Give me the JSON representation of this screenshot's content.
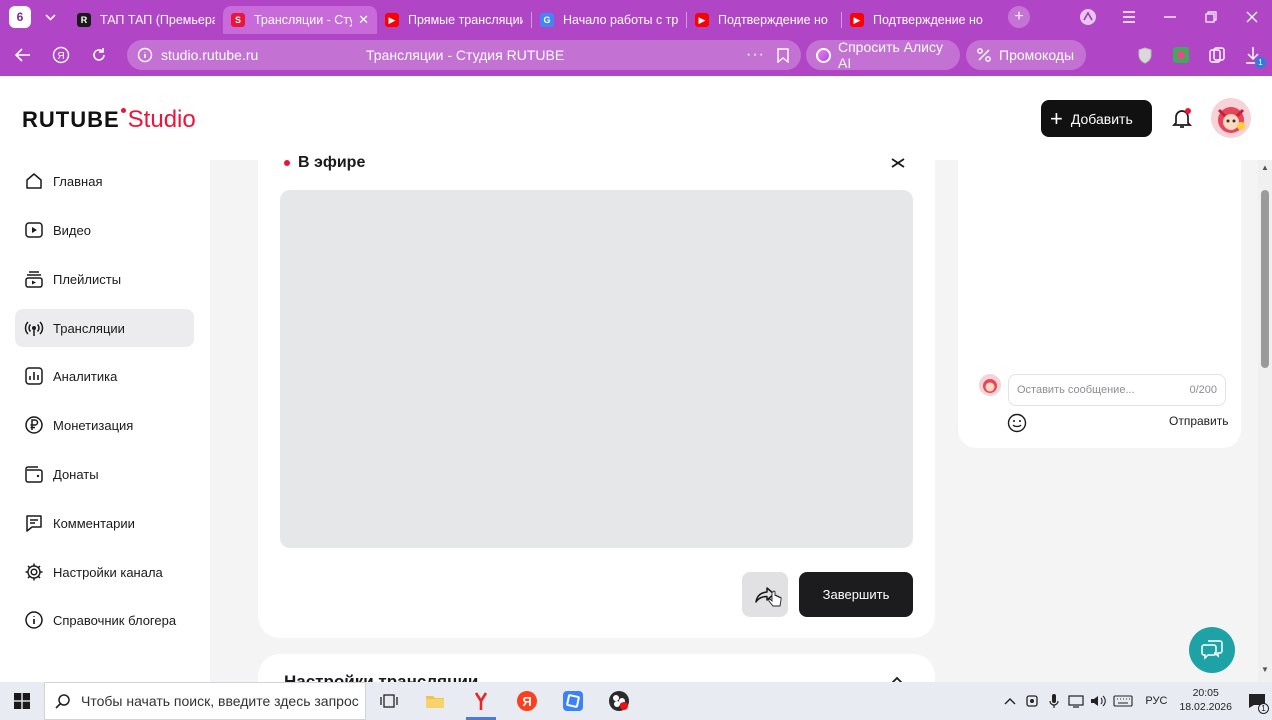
{
  "browser": {
    "tab_counter": "6",
    "tabs": [
      {
        "title": "ТАП ТАП (Премьера",
        "favicon": "rutube-favicon",
        "color": "#1a1a1a",
        "letter": "R"
      },
      {
        "title": "Трансляции - Сту",
        "favicon": "studio-favicon",
        "color": "#ed143b",
        "letter": "S",
        "active": true
      },
      {
        "title": "Прямые трансляции",
        "favicon": "youtube-favicon",
        "color": "#ff0000",
        "letter": "▶"
      },
      {
        "title": "Начало работы с тр",
        "favicon": "google-favicon",
        "color": "#4285f4",
        "letter": "G"
      },
      {
        "title": "Подтверждение но",
        "favicon": "youtube-favicon",
        "color": "#ff0000",
        "letter": "▶"
      },
      {
        "title": "Подтверждение но",
        "favicon": "youtube-favicon",
        "color": "#ff0000",
        "letter": "▶"
      }
    ],
    "url": "studio.rutube.ru",
    "page_title": "Трансляции - Студия RUTUBE",
    "alice_label": "Спросить Алису AI",
    "promo_label": "Промокоды",
    "ext_badge": "1"
  },
  "header": {
    "logo_main": "RUTUBE",
    "logo_studio": "Studio",
    "add_label": "Добавить"
  },
  "sidebar": {
    "items": [
      {
        "label": "Главная",
        "icon": "home-icon"
      },
      {
        "label": "Видео",
        "icon": "video-icon"
      },
      {
        "label": "Плейлисты",
        "icon": "playlist-icon"
      },
      {
        "label": "Трансляции",
        "icon": "broadcast-icon",
        "active": true
      },
      {
        "label": "Аналитика",
        "icon": "analytics-icon"
      },
      {
        "label": "Монетизация",
        "icon": "ruble-icon"
      },
      {
        "label": "Донаты",
        "icon": "wallet-icon"
      },
      {
        "label": "Комментарии",
        "icon": "comment-icon"
      },
      {
        "label": "Настройки канала",
        "icon": "gear-icon"
      },
      {
        "label": "Справочник блогера",
        "icon": "info-icon"
      }
    ]
  },
  "stream": {
    "status": "В эфире",
    "finish_label": "Завершить",
    "settings_title": "Настройки трансляции"
  },
  "chat": {
    "placeholder": "Оставить сообщение...",
    "counter": "0/200",
    "send_label": "Отправить"
  },
  "taskbar": {
    "search_placeholder": "Чтобы начать поиск, введите здесь запрос",
    "lang": "РУС",
    "time": "20:05",
    "date": "18.02.2026",
    "notif_count": "1"
  },
  "colors": {
    "browser_purple": "#b046c6",
    "rutube_red": "#ed143b",
    "help_teal": "#1ea2a6",
    "button_dark": "#1c1c1e"
  }
}
